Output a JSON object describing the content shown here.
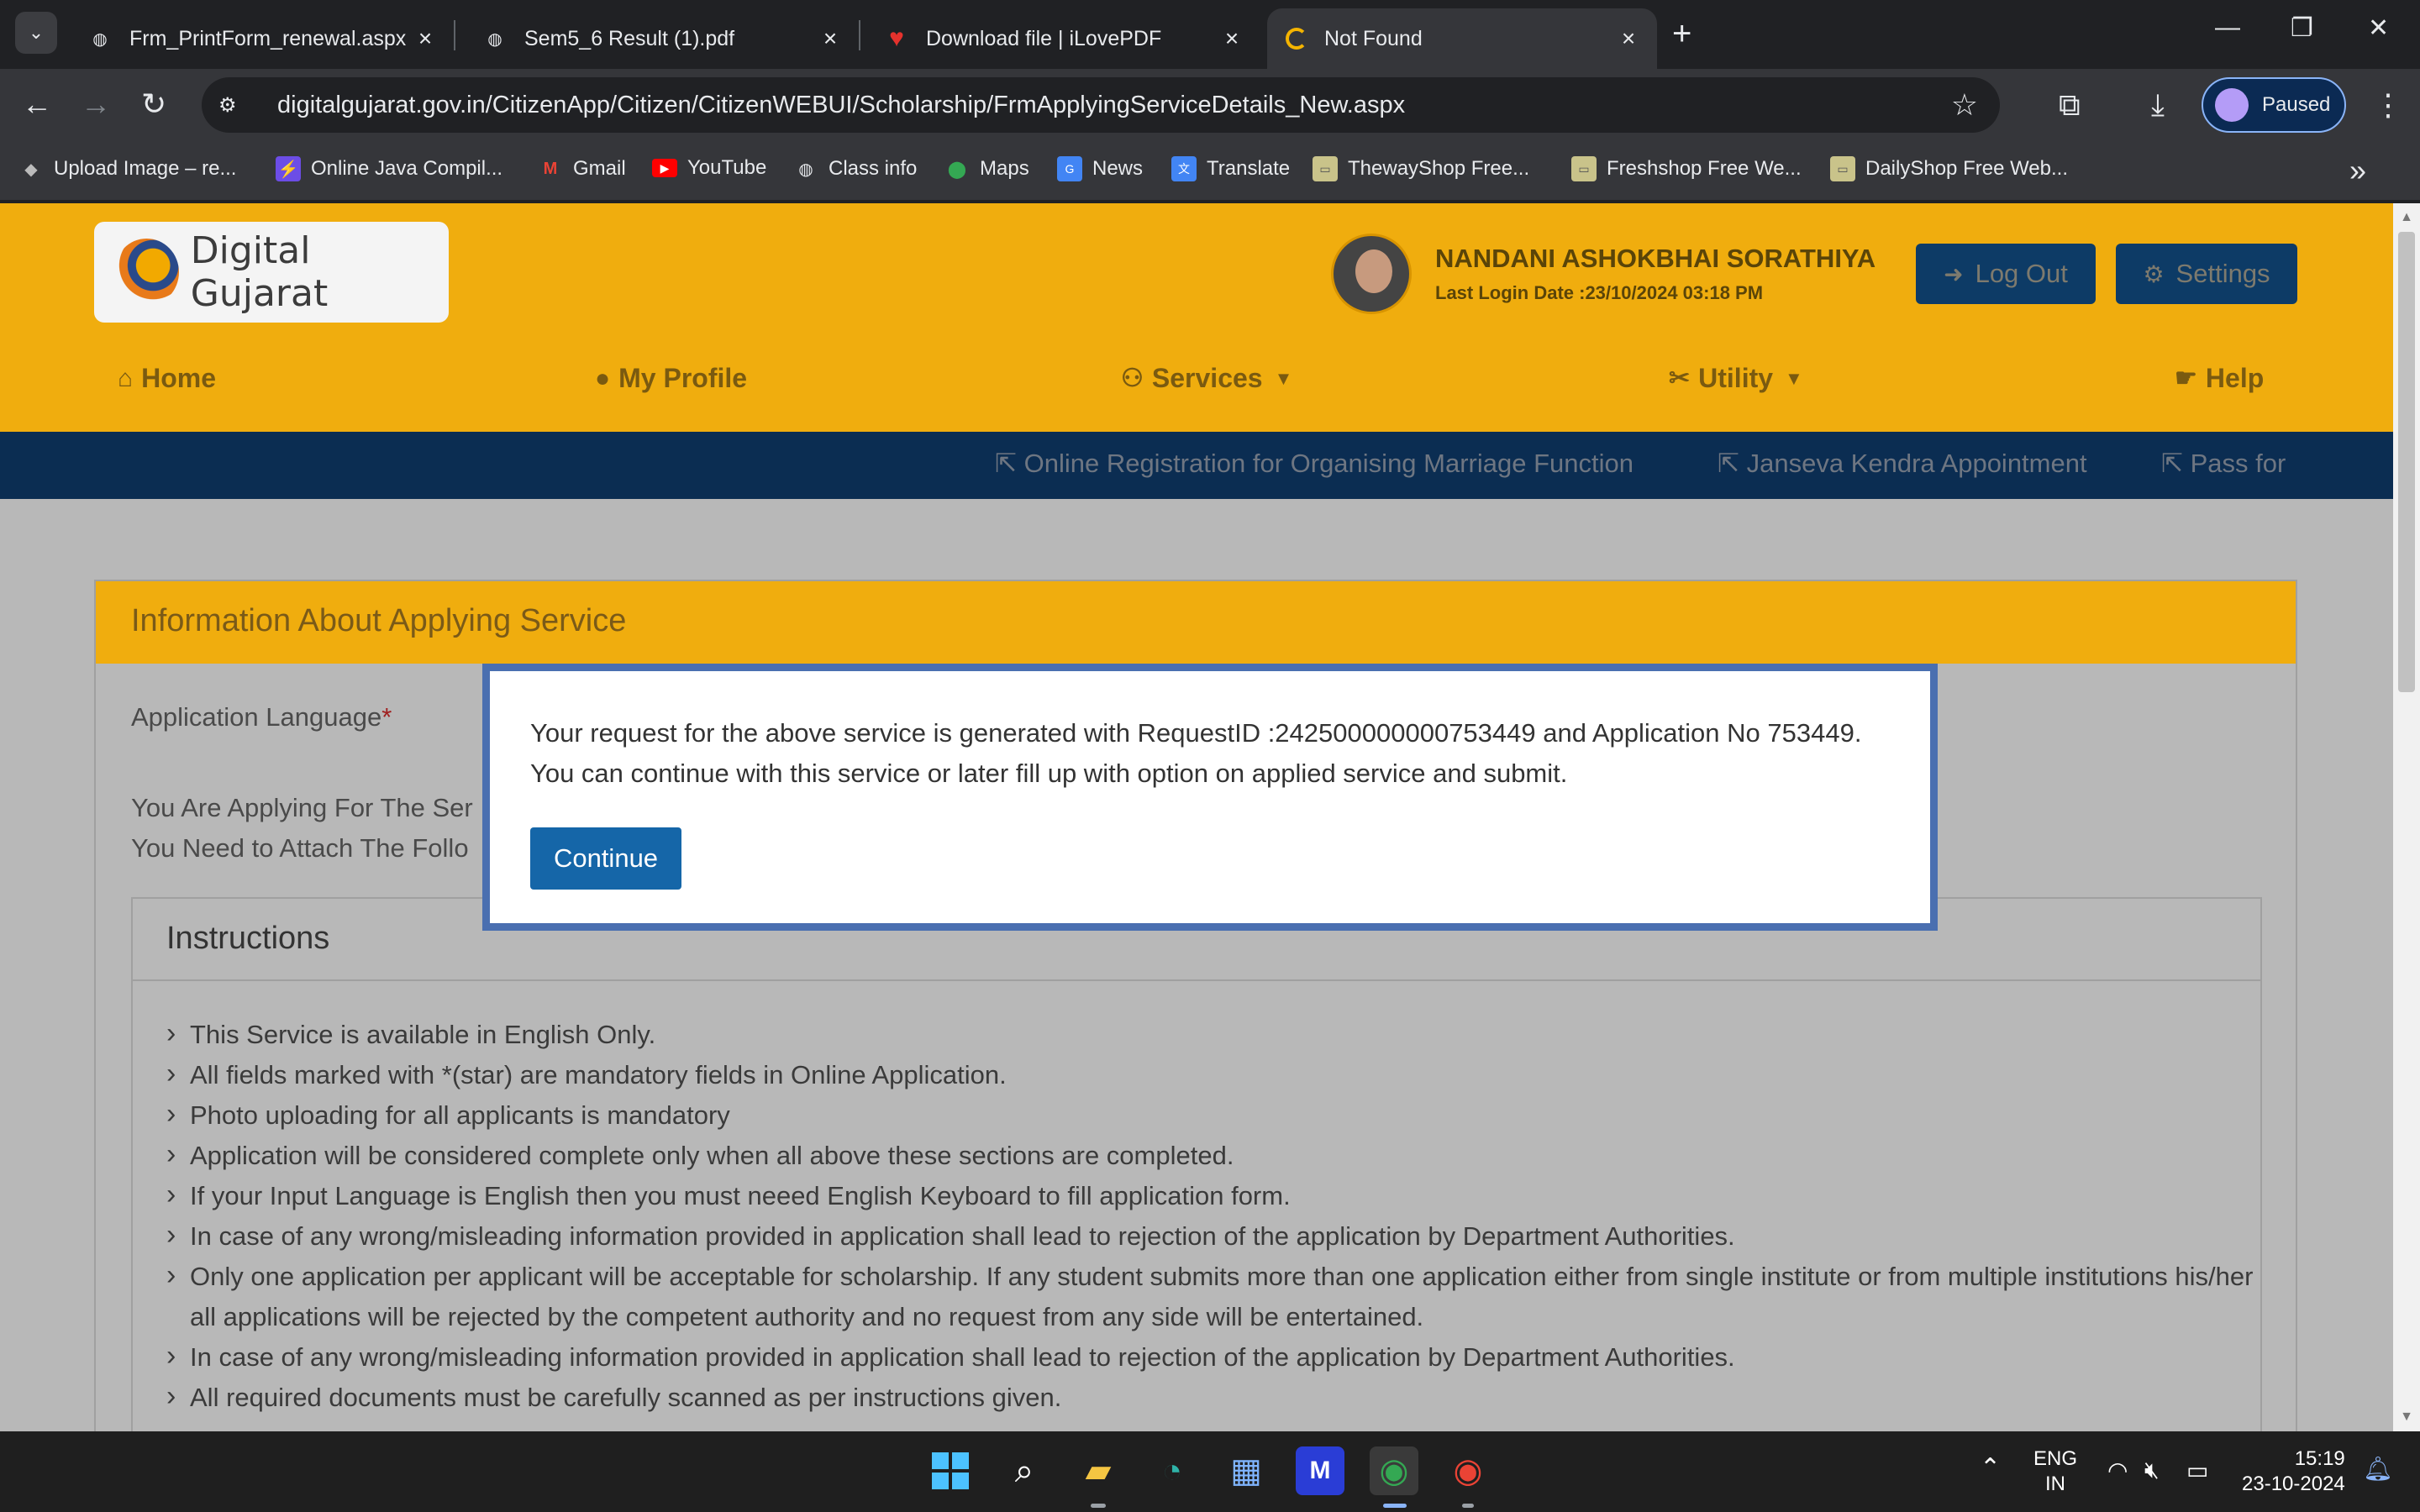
{
  "browser": {
    "tabs": [
      {
        "title": "Frm_PrintForm_renewal.aspx",
        "icon": "globe-icon"
      },
      {
        "title": "Sem5_6 Result (1).pdf",
        "icon": "globe-icon"
      },
      {
        "title": "Download file | iLovePDF",
        "icon": "heart-icon"
      },
      {
        "title": "Not Found",
        "icon": "spinner-icon"
      }
    ],
    "url": "digitalgujarat.gov.in/CitizenApp/Citizen/CitizenWEBUI/Scholarship/FrmApplyingServiceDetails_New.aspx",
    "profile_label": "Paused",
    "bookmarks": [
      "Upload Image – re...",
      "Online Java Compil...",
      "Gmail",
      "YouTube",
      "Class info",
      "Maps",
      "News",
      "Translate",
      "ThewayShop Free...",
      "Freshshop Free We...",
      "DailyShop Free Web..."
    ]
  },
  "site": {
    "logo_text": "Digital Gujarat",
    "user_name": "NANDANI ASHOKBHAI SORATHIYA",
    "last_login": "Last Login Date :23/10/2024 03:18 PM",
    "logout_label": "Log Out",
    "settings_label": "Settings",
    "nav": [
      "Home",
      "My Profile",
      "Services",
      "Utility",
      "Help"
    ],
    "subnav": [
      "Online Registration for Organising Marriage Function",
      "Janseva Kendra Appointment",
      "Pass for"
    ]
  },
  "panel": {
    "title": "Information About Applying Service",
    "application_language_label": "Application Language",
    "required_mark": "*",
    "applying_for_text": "You Are Applying For The Ser",
    "attach_text": "You Need to Attach The Follo",
    "instructions_title": "Instructions",
    "instructions": [
      "This Service is available in English Only.",
      "All fields marked with *(star) are mandatory fields in Online Application.",
      "Photo uploading for all applicants is mandatory",
      "Application will be considered complete only when all above these sections are completed.",
      "If your Input Language is English then you must neeed English Keyboard to fill application form.",
      "In case of any wrong/misleading information provided in application shall lead to rejection of the application by Department Authorities.",
      "Only one application per applicant will be acceptable for scholarship. If any student submits more than one application either from single institute or from multiple institutions his/her all applications will be rejected by the competent authority and no request from any side will be entertained.",
      "In case of any wrong/misleading information provided in application shall lead to rejection of the application by Department Authorities.",
      "All required documents must be carefully scanned as per instructions given."
    ]
  },
  "modal": {
    "message_line1": "Your request for the above service is generated with RequestID :242500000000753449 and Application No 753449.",
    "message_line2": "You can continue with this service or later fill up with option on applied service and submit.",
    "continue_label": "Continue"
  },
  "taskbar": {
    "lang_top": "ENG",
    "lang_bottom": "IN",
    "time": "15:19",
    "date": "23-10-2024"
  }
}
